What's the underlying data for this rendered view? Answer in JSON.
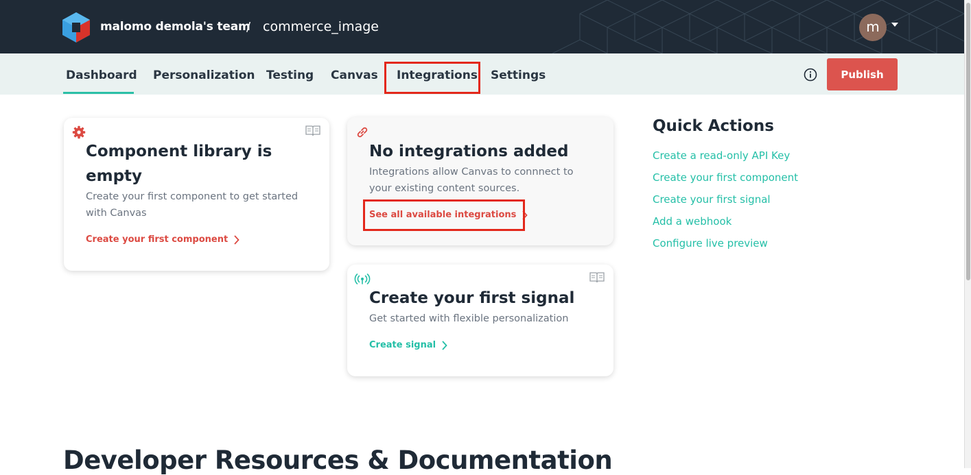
{
  "header": {
    "team_name": "malomo demola's team",
    "separator": "/",
    "project_name": "commerce_image",
    "avatar_letter": "m"
  },
  "nav": {
    "tabs": [
      {
        "label": "Dashboard",
        "active": true
      },
      {
        "label": "Personalization"
      },
      {
        "label": "Testing"
      },
      {
        "label": "Canvas"
      },
      {
        "label": "Integrations",
        "highlighted": true
      },
      {
        "label": "Settings"
      }
    ],
    "publish_label": "Publish"
  },
  "cards": {
    "component": {
      "title_line1": "Component library is",
      "title_line2": "empty",
      "desc_line1": "Create your first component to get started",
      "desc_line2": "with Canvas",
      "link": "Create your first component"
    },
    "integrations": {
      "title": "No integrations added",
      "desc_line1": "Integrations allow Canvas to connnect to",
      "desc_line2": "your existing content sources.",
      "link": "See all available integrations"
    },
    "signal": {
      "title": "Create your first signal",
      "desc": "Get started with flexible personalization",
      "link": "Create signal"
    }
  },
  "quick_actions": {
    "title": "Quick Actions",
    "links": [
      "Create a read-only API Key",
      "Create your first component",
      "Create your first signal",
      "Add a webhook",
      "Configure live preview"
    ]
  },
  "developer": {
    "title": "Developer Resources & Documentation"
  },
  "colors": {
    "header_bg": "#1f2a36",
    "nav_bg": "#eaf2f1",
    "accent_teal": "#24bfa7",
    "accent_red": "#dc544e",
    "highlight_red": "#e3281b"
  }
}
